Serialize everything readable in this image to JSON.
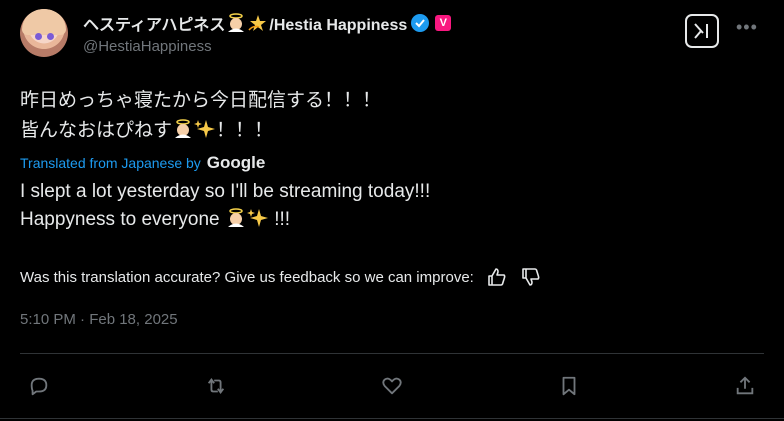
{
  "author": {
    "display_name": "ヘスティアハピネス",
    "display_name_suffix": "/Hestia Happiness",
    "handle": "@HestiaHappiness",
    "badge_letter": "V"
  },
  "post": {
    "original_line1": "昨日めっちゃ寝たから今日配信する！！！",
    "original_line2_prefix": "皆んなおはぴねす",
    "original_line2_suffix": "！！！",
    "translated_from": "Translated from Japanese by",
    "translator_brand": "Google",
    "translation_line1": "I slept a lot yesterday so I'll be streaming today!!!",
    "translation_line2_prefix": "Happyness to everyone",
    "translation_line2_suffix": "!!!",
    "feedback_prompt": "Was this translation accurate? Give us feedback so we can improve:",
    "timestamp": "5:10 PM · Feb 18, 2025"
  },
  "icons": {
    "verified": "verified-check-icon",
    "grok": "grok-icon",
    "more": "more-icon",
    "reply": "reply-icon",
    "repost": "repost-icon",
    "like": "heart-icon",
    "bookmark": "bookmark-icon",
    "share": "share-icon"
  },
  "colors": {
    "background": "#000000",
    "text": "#e7e9ea",
    "muted": "#71767b",
    "accent": "#1d9bf0",
    "badge": "#f91880"
  }
}
